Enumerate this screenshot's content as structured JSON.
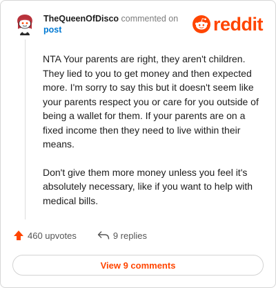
{
  "header": {
    "username": "TheQueenOfDisco",
    "action_text": " commented on",
    "target_link": "post"
  },
  "brand": {
    "wordmark": "reddit",
    "color": "#ff4500",
    "icon": "reddit-snoo-icon"
  },
  "comment": {
    "paragraphs": [
      "NTA Your parents are right, they aren't children. They lied to you to get money and then expected more. I'm sorry to say this but it doesn't seem like your parents respect you or care for you outside of being a wallet for them. If your parents are on a fixed income then they need to live within their means.",
      "Don't give them more money unless you feel it's absolutely necessary, like if you want to help with medical bills."
    ]
  },
  "actions": {
    "upvotes_label": "460 upvotes",
    "replies_label": "9 replies",
    "upvote_icon": "upvote-arrow-icon",
    "reply_icon": "reply-arrow-icon"
  },
  "footer": {
    "view_comments_label": "View 9 comments"
  },
  "colors": {
    "accent": "#ff4500",
    "link": "#0079d3",
    "muted": "#7c7c7c"
  }
}
